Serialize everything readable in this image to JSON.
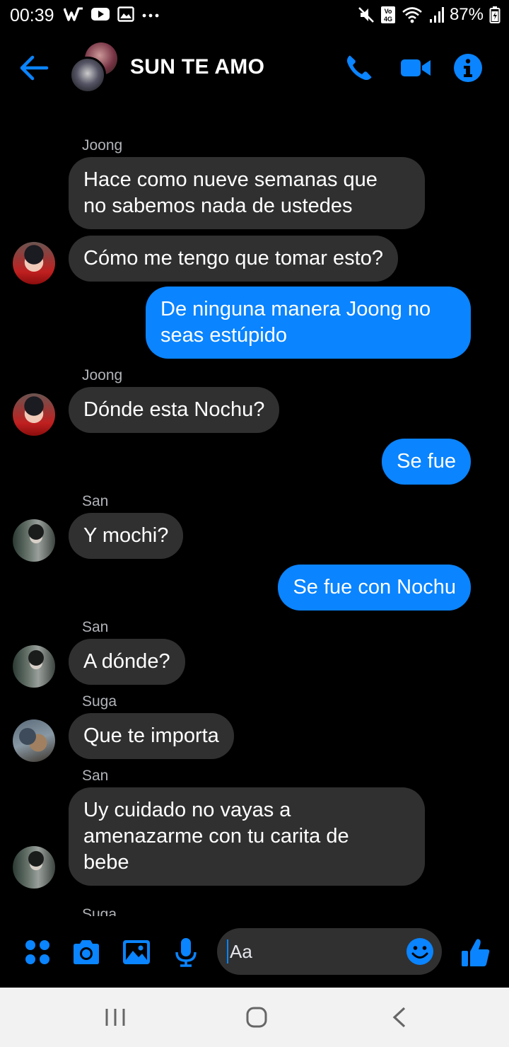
{
  "status_bar": {
    "time": "00:39",
    "battery": "87%",
    "icons": [
      "w-icon",
      "youtube-icon",
      "gallery-icon",
      "more-dots-icon",
      "mute-icon",
      "volte-4g-icon",
      "wifi-icon",
      "signal-icon",
      "battery-icon"
    ]
  },
  "header": {
    "title": "SUN TE AMO",
    "icons": [
      "back-arrow-icon",
      "phone-icon",
      "video-camera-icon",
      "info-icon"
    ]
  },
  "colors": {
    "accent": "#0a84ff",
    "incoming_bubble": "#303030",
    "background": "#000000",
    "sender_label": "#b0b3b8"
  },
  "messages": [
    {
      "sender": "Joong",
      "text_lines": [
        "Hace como nueve semanas que",
        "no sabemos nada de  ustedes"
      ],
      "direction": "in"
    },
    {
      "sender": "",
      "text_lines": [
        "Cómo me tengo que tomar esto?"
      ],
      "direction": "in"
    },
    {
      "sender": "",
      "text_lines": [
        "De ninguna manera Joong no",
        "seas estúpido"
      ],
      "direction": "out"
    },
    {
      "sender": "Joong",
      "text_lines": [
        "Dónde esta Nochu?"
      ],
      "direction": "in"
    },
    {
      "sender": "",
      "text_lines": [
        "Se fue"
      ],
      "direction": "out"
    },
    {
      "sender": "San",
      "text_lines": [
        "Y mochi?"
      ],
      "direction": "in"
    },
    {
      "sender": "",
      "text_lines": [
        "Se fue con Nochu"
      ],
      "direction": "out"
    },
    {
      "sender": "San",
      "text_lines": [
        "A dónde?"
      ],
      "direction": "in"
    },
    {
      "sender": "Suga",
      "text_lines": [
        "Que te importa"
      ],
      "direction": "in"
    },
    {
      "sender": "San",
      "text_lines": [
        "Uy cuidado no vayas a",
        "amenazarme con tu carita de",
        "bebe"
      ],
      "direction": "in"
    },
    {
      "sender": "Suga",
      "text_lines": [],
      "direction": "in"
    }
  ],
  "composer": {
    "placeholder": "Aa",
    "icons": [
      "apps-dots-icon",
      "camera-icon",
      "image-icon",
      "microphone-icon",
      "emoji-icon",
      "thumbs-up-icon"
    ]
  },
  "nav_bar": {
    "icons": [
      "recents-icon",
      "home-icon",
      "back-icon"
    ]
  }
}
